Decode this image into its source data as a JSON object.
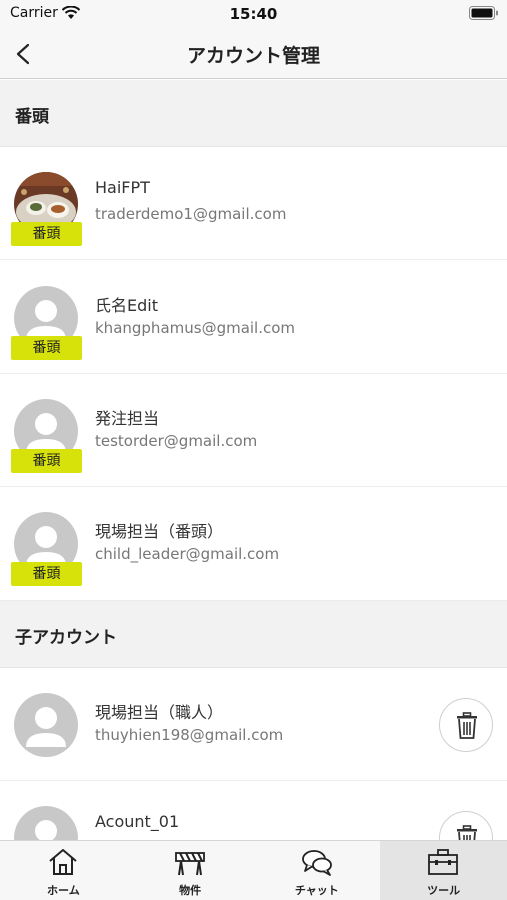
{
  "status_bar": {
    "carrier": "Carrier",
    "time": "15:40"
  },
  "nav": {
    "title": "アカウント管理"
  },
  "sections": {
    "leaders": {
      "title": "番頭",
      "rows": [
        {
          "name": "HaiFPT",
          "email": "traderdemo1@gmail.com",
          "badge": "番頭"
        },
        {
          "name": "氏名Edit",
          "email": "khangphamus@gmail.com",
          "badge": "番頭"
        },
        {
          "name": "発注担当",
          "email": "testorder@gmail.com",
          "badge": "番頭"
        },
        {
          "name": "現場担当（番頭）",
          "email": "child_leader@gmail.com",
          "badge": "番頭"
        }
      ]
    },
    "children": {
      "title": "子アカウント",
      "rows": [
        {
          "name": "現場担当（職人）",
          "email": "thuyhien198@gmail.com"
        },
        {
          "name": "Acount_01",
          "email": ""
        }
      ]
    }
  },
  "tabs": [
    {
      "label": "ホーム",
      "icon": "home-icon"
    },
    {
      "label": "物件",
      "icon": "barrier-icon"
    },
    {
      "label": "チャット",
      "icon": "chat-icon"
    },
    {
      "label": "ツール",
      "icon": "toolbox-icon",
      "active": true
    }
  ],
  "colors": {
    "badge": "#d6e20a",
    "header_bg": "#f2f2f2",
    "active_tab": "#e4e4e4"
  }
}
